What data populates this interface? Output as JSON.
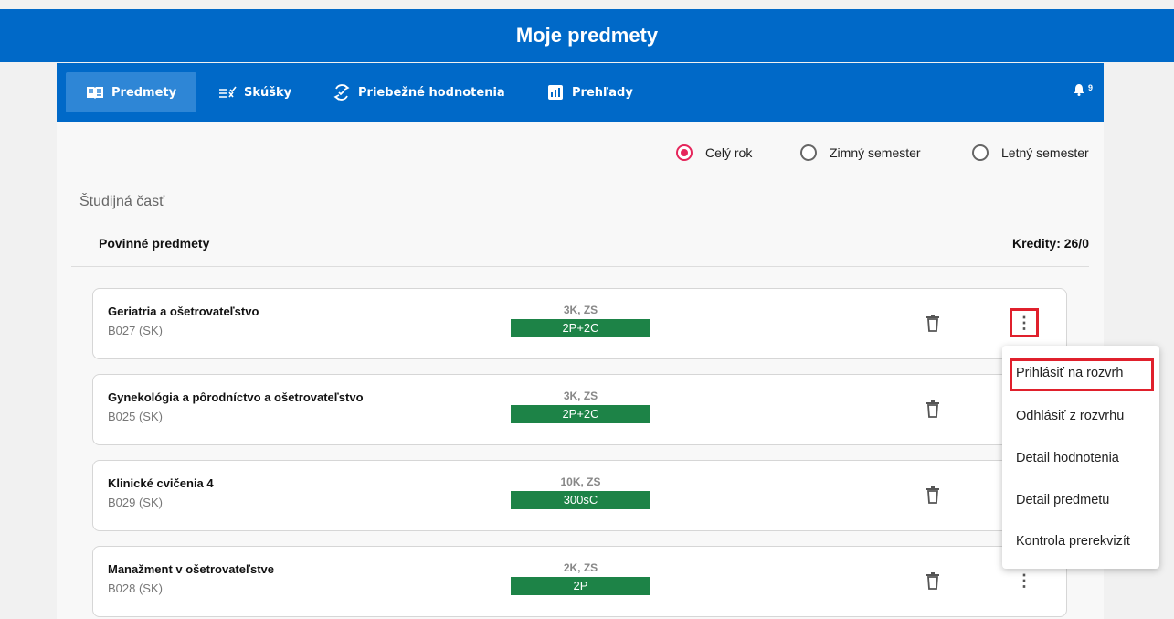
{
  "header": {
    "title": "Moje predmety"
  },
  "nav": {
    "tabs": [
      {
        "label": "Predmety",
        "icon": "book-icon",
        "active": true
      },
      {
        "label": "Skúšky",
        "icon": "checklist-icon",
        "active": false
      },
      {
        "label": "Priebežné hodnotenia",
        "icon": "refresh-check-icon",
        "active": false
      },
      {
        "label": "Prehľady",
        "icon": "bar-chart-icon",
        "active": false
      }
    ],
    "notifications": {
      "icon": "bell-icon",
      "count": "9"
    }
  },
  "filters": {
    "options": [
      {
        "label": "Celý rok",
        "selected": true
      },
      {
        "label": "Zimný semester",
        "selected": false
      },
      {
        "label": "Letný semester",
        "selected": false
      }
    ]
  },
  "section": {
    "label": "Študijná časť"
  },
  "group": {
    "title": "Povinné predmety",
    "credits": "Kredity: 26/0"
  },
  "courses": [
    {
      "name": "Geriatria a ošetrovateľstvo",
      "code": "B027 (SK)",
      "meta": "3K, ZS",
      "badge": "2P+2C"
    },
    {
      "name": "Gynekológia a pôrodníctvo a ošetrovateľstvo",
      "code": "B025 (SK)",
      "meta": "3K, ZS",
      "badge": "2P+2C"
    },
    {
      "name": "Klinické cvičenia 4",
      "code": "B029 (SK)",
      "meta": "10K, ZS",
      "badge": "300sC"
    },
    {
      "name": "Manažment v ošetrovateľstve",
      "code": "B028 (SK)",
      "meta": "2K, ZS",
      "badge": "2P"
    }
  ],
  "context_menu": {
    "items": [
      "Prihlásiť na rozvrh",
      "Odhlásiť z rozvrhu",
      "Detail hodnotenia",
      "Detail predmetu",
      "Kontrola prerekvizít"
    ]
  },
  "colors": {
    "primary": "#0069c8",
    "active_tab": "#2e86d6",
    "badge_green": "#1d8347",
    "radio_selected": "#e5265b",
    "highlight_red": "#e0202c"
  }
}
